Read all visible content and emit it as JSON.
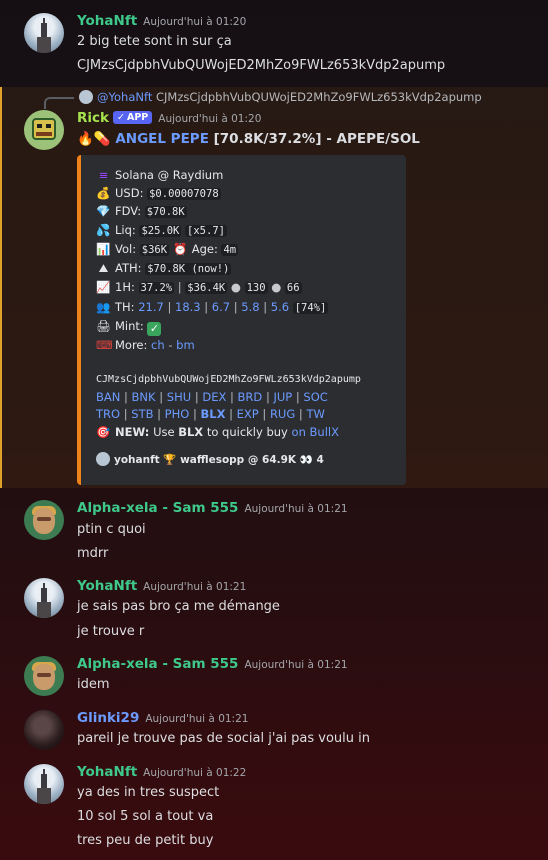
{
  "messages": [
    {
      "user": "YohaNft",
      "time": "Aujourd'hui à 01:20",
      "lines": [
        "2 big tete sont in sur ça",
        "CJMzsCjdpbhVubQUWojED2MhZo9FWLz653kVdp2apump"
      ]
    },
    {
      "user": "Alpha-xela - Sam 555",
      "time": "Aujourd'hui à 01:21",
      "lines": [
        "ptin c quoi",
        "mdrr"
      ]
    },
    {
      "user": "YohaNft",
      "time": "Aujourd'hui à 01:21",
      "lines": [
        "je sais pas bro ça me démange",
        "je trouve r"
      ]
    },
    {
      "user": "Alpha-xela - Sam 555",
      "time": "Aujourd'hui à 01:21",
      "lines": [
        "idem"
      ]
    },
    {
      "user": "Glinki29",
      "time": "Aujourd'hui à 01:21",
      "lines": [
        "pareil je trouve pas de social j'ai pas voulu in"
      ]
    },
    {
      "user": "YohaNft",
      "time": "Aujourd'hui à 01:22",
      "lines": [
        "ya des in tres suspect",
        "10 sol 5 sol a tout va",
        "tres peu de petit buy"
      ]
    }
  ],
  "reply": {
    "mention": "@YohaNft",
    "text": "CJMzsCjdpbhVubQUWojED2MhZo9FWLz653kVdp2apump"
  },
  "bot": {
    "user": "Rick",
    "badge": "APP",
    "time": "Aujourd'hui à 01:20",
    "title_emojis": "🔥💊",
    "title_link": "ANGEL PEPE",
    "title_rest": " [70.8K/37.2%] - APEPE/SOL"
  },
  "embed": {
    "chain": "Solana @ Raydium",
    "usd_label": "USD:",
    "usd_value": "$0.00007078",
    "fdv_label": "FDV:",
    "fdv_value": "$70.8K",
    "liq_label": "Liq:",
    "liq_value": "$25.0K",
    "liq_mult": "[x5.7]",
    "vol_label": "Vol:",
    "vol_value": "$36K",
    "age_label": "Age:",
    "age_value": "4m",
    "ath_label": "ATH:",
    "ath_value": "$70.8K (now!)",
    "h1_label": "1H:",
    "h1_pct": "37.2%",
    "h1_vol": "$36.4K",
    "h1_buys": "130",
    "h1_sells": "66",
    "th_label": "TH:",
    "th_values": [
      "21.7",
      "18.3",
      "6.7",
      "5.8",
      "5.6"
    ],
    "th_total": "[74%]",
    "mint_label": "Mint:",
    "more_label": "More:",
    "more_links": [
      "ch",
      "bm"
    ],
    "contract": "CJMzsCjdpbhVubQUWojED2MhZo9FWLz653kVdp2apump",
    "links_row1": [
      "BAN",
      "BNK",
      "SHU",
      "DEX",
      "BRD",
      "JUP",
      "SOC"
    ],
    "links_row2": [
      "TRO",
      "STB",
      "PHO",
      "BLX",
      "EXP",
      "RUG",
      "TW"
    ],
    "new_label": "NEW:",
    "new_text_a": "Use",
    "new_bold": "BLX",
    "new_text_b": "to quickly buy",
    "new_link": "on BullX",
    "footer_user": "yohanft",
    "footer_trophy": "🏆",
    "footer_text": "wafflesopp @ 64.9K",
    "footer_eyes": "👀",
    "footer_count": "4"
  },
  "colors": {
    "green_user": "#3ec98b",
    "blue_user": "#6c9bff",
    "bot_user": "#a6e34f",
    "embed_bar": "#f0821a",
    "highlight_bar": "#e0a12a"
  }
}
